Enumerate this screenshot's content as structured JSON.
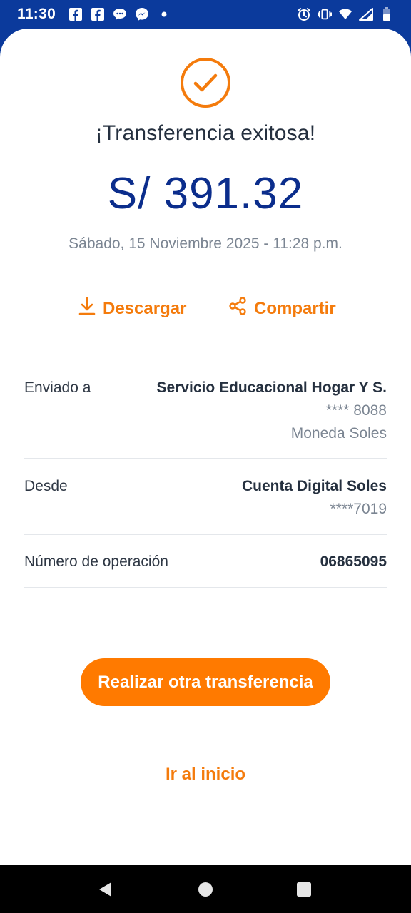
{
  "status_bar": {
    "time": "11:30",
    "left_icons": [
      "facebook-icon",
      "facebook-icon",
      "chat-bubble-icon",
      "messenger-icon",
      "dot-icon"
    ],
    "right_icons": [
      "alarm-icon",
      "vibrate-icon",
      "wifi-icon",
      "signal-icon",
      "battery-icon"
    ]
  },
  "result": {
    "title": "¡Transferencia exitosa!",
    "amount": "S/ 391.32",
    "datetime": "Sábado, 15 Noviembre 2025 - 11:28 p.m."
  },
  "actions": {
    "download_label": "Descargar",
    "share_label": "Compartir"
  },
  "details": {
    "sent_to": {
      "label": "Enviado a",
      "name": "Servicio Educacional Hogar Y S.",
      "account": "**** 8088",
      "currency": "Moneda Soles"
    },
    "from": {
      "label": "Desde",
      "name": "Cuenta Digital Soles",
      "account": "****7019"
    },
    "operation": {
      "label": "Número de operación",
      "number": "06865095"
    }
  },
  "buttons": {
    "new_transfer": "Realizar otra transferencia",
    "go_home": "Ir al inicio"
  },
  "colors": {
    "brand_blue": "#0b3a9c",
    "amount_blue": "#0b2d8c",
    "accent_orange": "#ff7a00"
  }
}
